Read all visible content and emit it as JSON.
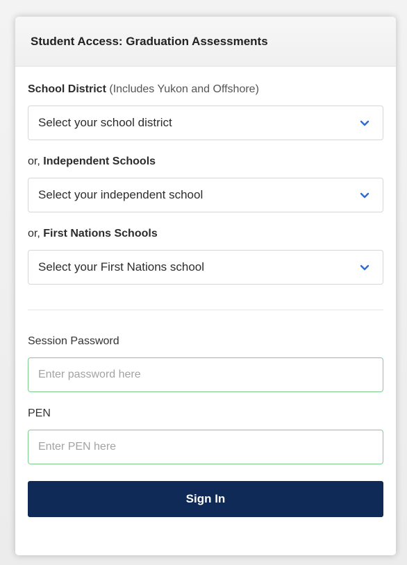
{
  "card": {
    "title": "Student Access: Graduation Assessments"
  },
  "school_district": {
    "label_bold": "School District",
    "label_note": "(Includes Yukon and Offshore)",
    "select_value": "Select your school district",
    "icon": "chevron-down-icon"
  },
  "independent": {
    "prefix": "or,",
    "label_bold": "Independent Schools",
    "select_value": "Select your independent school",
    "icon": "chevron-down-icon"
  },
  "first_nations": {
    "prefix": "or,",
    "label_bold": "First Nations Schools",
    "select_value": "Select your First Nations school",
    "icon": "chevron-down-icon"
  },
  "password": {
    "label": "Session Password",
    "placeholder": "Enter password here"
  },
  "pen": {
    "label": "PEN",
    "placeholder": "Enter PEN here"
  },
  "signin": {
    "label": "Sign In"
  },
  "colors": {
    "button_bg": "#0f2a57",
    "chevron": "#2b6cd0",
    "input_focus_border": "#7ccf8e"
  }
}
